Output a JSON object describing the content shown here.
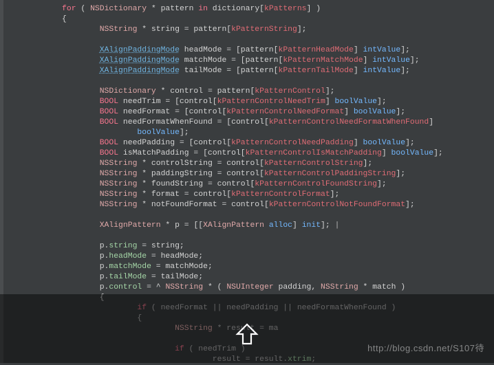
{
  "watermark": "http://blog.csdn.net/S107待",
  "lines": [
    {
      "indent": 3,
      "tokens": [
        {
          "t": "for",
          "c": "kw"
        },
        {
          "t": " ( ",
          "c": "pl"
        },
        {
          "t": "NSDictionary",
          "c": "type"
        },
        {
          "t": " * pattern ",
          "c": "pl"
        },
        {
          "t": "in",
          "c": "kw"
        },
        {
          "t": " dictionary[",
          "c": "pl"
        },
        {
          "t": "kPatterns",
          "c": "key"
        },
        {
          "t": "] )",
          "c": "pl"
        }
      ]
    },
    {
      "indent": 3,
      "tokens": [
        {
          "t": "{",
          "c": "pl"
        }
      ]
    },
    {
      "indent": 5,
      "tokens": [
        {
          "t": "NSString",
          "c": "type"
        },
        {
          "t": " * string = pattern[",
          "c": "pl"
        },
        {
          "t": "kPatternString",
          "c": "key"
        },
        {
          "t": "];",
          "c": "pl"
        }
      ]
    },
    {
      "indent": 0,
      "tokens": []
    },
    {
      "indent": 5,
      "tokens": [
        {
          "t": "XAlignPaddingMode",
          "c": "link"
        },
        {
          "t": " headMode = [pattern[",
          "c": "pl"
        },
        {
          "t": "kPatternHeadMode",
          "c": "key"
        },
        {
          "t": "] ",
          "c": "pl"
        },
        {
          "t": "intValue",
          "c": "msg"
        },
        {
          "t": "];",
          "c": "pl"
        }
      ]
    },
    {
      "indent": 5,
      "tokens": [
        {
          "t": "XAlignPaddingMode",
          "c": "link"
        },
        {
          "t": " matchMode = [pattern[",
          "c": "pl"
        },
        {
          "t": "kPatternMatchMode",
          "c": "key"
        },
        {
          "t": "] ",
          "c": "pl"
        },
        {
          "t": "intValue",
          "c": "msg"
        },
        {
          "t": "];",
          "c": "pl"
        }
      ]
    },
    {
      "indent": 5,
      "tokens": [
        {
          "t": "XAlignPaddingMode",
          "c": "link"
        },
        {
          "t": " tailMode = [pattern[",
          "c": "pl"
        },
        {
          "t": "kPatternTailMode",
          "c": "key"
        },
        {
          "t": "] ",
          "c": "pl"
        },
        {
          "t": "intValue",
          "c": "msg"
        },
        {
          "t": "];",
          "c": "pl"
        }
      ]
    },
    {
      "indent": 0,
      "tokens": []
    },
    {
      "indent": 5,
      "tokens": [
        {
          "t": "NSDictionary",
          "c": "type"
        },
        {
          "t": " * control = pattern[",
          "c": "pl"
        },
        {
          "t": "kPatternControl",
          "c": "key"
        },
        {
          "t": "];",
          "c": "pl"
        }
      ]
    },
    {
      "indent": 5,
      "tokens": [
        {
          "t": "BOOL",
          "c": "kw"
        },
        {
          "t": " needTrim = [control[",
          "c": "pl"
        },
        {
          "t": "kPatternControlNeedTrim",
          "c": "key"
        },
        {
          "t": "] ",
          "c": "pl"
        },
        {
          "t": "boolValue",
          "c": "msg"
        },
        {
          "t": "];",
          "c": "pl"
        }
      ]
    },
    {
      "indent": 5,
      "tokens": [
        {
          "t": "BOOL",
          "c": "kw"
        },
        {
          "t": " needFormat = [control[",
          "c": "pl"
        },
        {
          "t": "kPatternControlNeedFormat",
          "c": "key"
        },
        {
          "t": "] ",
          "c": "pl"
        },
        {
          "t": "boolValue",
          "c": "msg"
        },
        {
          "t": "];",
          "c": "pl"
        }
      ]
    },
    {
      "indent": 5,
      "tokens": [
        {
          "t": "BOOL",
          "c": "kw"
        },
        {
          "t": " needFormatWhenFound = [control[",
          "c": "pl"
        },
        {
          "t": "kPatternControlNeedFormatWhenFound",
          "c": "key"
        },
        {
          "t": "] ",
          "c": "pl"
        }
      ]
    },
    {
      "indent": 7,
      "tokens": [
        {
          "t": "boolValue",
          "c": "msg"
        },
        {
          "t": "];",
          "c": "pl"
        }
      ]
    },
    {
      "indent": 5,
      "tokens": [
        {
          "t": "BOOL",
          "c": "kw"
        },
        {
          "t": " needPadding = [control[",
          "c": "pl"
        },
        {
          "t": "kPatternControlNeedPadding",
          "c": "key"
        },
        {
          "t": "] ",
          "c": "pl"
        },
        {
          "t": "boolValue",
          "c": "msg"
        },
        {
          "t": "];",
          "c": "pl"
        }
      ]
    },
    {
      "indent": 5,
      "tokens": [
        {
          "t": "BOOL",
          "c": "kw"
        },
        {
          "t": " isMatchPadding = [control[",
          "c": "pl"
        },
        {
          "t": "kPatternControlIsMatchPadding",
          "c": "key"
        },
        {
          "t": "] ",
          "c": "pl"
        },
        {
          "t": "boolValue",
          "c": "msg"
        },
        {
          "t": "];",
          "c": "pl"
        }
      ]
    },
    {
      "indent": 5,
      "tokens": [
        {
          "t": "NSString",
          "c": "type"
        },
        {
          "t": " * controlString = control[",
          "c": "pl"
        },
        {
          "t": "kPatternControlString",
          "c": "key"
        },
        {
          "t": "];",
          "c": "pl"
        }
      ]
    },
    {
      "indent": 5,
      "tokens": [
        {
          "t": "NSString",
          "c": "type"
        },
        {
          "t": " * paddingString = control[",
          "c": "pl"
        },
        {
          "t": "kPatternControlPaddingString",
          "c": "key"
        },
        {
          "t": "];",
          "c": "pl"
        }
      ]
    },
    {
      "indent": 5,
      "tokens": [
        {
          "t": "NSString",
          "c": "type"
        },
        {
          "t": " * foundString = control[",
          "c": "pl"
        },
        {
          "t": "kPatternControlFoundString",
          "c": "key"
        },
        {
          "t": "];",
          "c": "pl"
        }
      ]
    },
    {
      "indent": 5,
      "tokens": [
        {
          "t": "NSString",
          "c": "type"
        },
        {
          "t": " * format = control[",
          "c": "pl"
        },
        {
          "t": "kPatternControlFormat",
          "c": "key"
        },
        {
          "t": "];",
          "c": "pl"
        }
      ]
    },
    {
      "indent": 5,
      "tokens": [
        {
          "t": "NSString",
          "c": "type"
        },
        {
          "t": " * notFoundFormat = control[",
          "c": "pl"
        },
        {
          "t": "kPatternControlNotFoundFormat",
          "c": "key"
        },
        {
          "t": "];",
          "c": "pl"
        }
      ]
    },
    {
      "indent": 0,
      "tokens": []
    },
    {
      "indent": 5,
      "tokens": [
        {
          "t": "XAlignPattern",
          "c": "type"
        },
        {
          "t": " * p = [[",
          "c": "pl"
        },
        {
          "t": "XAlignPattern",
          "c": "type"
        },
        {
          "t": " ",
          "c": "pl"
        },
        {
          "t": "alloc",
          "c": "msg"
        },
        {
          "t": "] ",
          "c": "pl"
        },
        {
          "t": "init",
          "c": "msg"
        },
        {
          "t": "]; ",
          "c": "pl"
        },
        {
          "t": "|",
          "c": "dim"
        }
      ]
    },
    {
      "indent": 0,
      "tokens": []
    },
    {
      "indent": 5,
      "tokens": [
        {
          "t": "p.",
          "c": "pl"
        },
        {
          "t": "string",
          "c": "prop"
        },
        {
          "t": " = string;",
          "c": "pl"
        }
      ]
    },
    {
      "indent": 5,
      "tokens": [
        {
          "t": "p.",
          "c": "pl"
        },
        {
          "t": "headMode",
          "c": "prop"
        },
        {
          "t": " = headMode;",
          "c": "pl"
        }
      ]
    },
    {
      "indent": 5,
      "tokens": [
        {
          "t": "p.",
          "c": "pl"
        },
        {
          "t": "matchMode",
          "c": "prop"
        },
        {
          "t": " = matchMode;",
          "c": "pl"
        }
      ]
    },
    {
      "indent": 5,
      "tokens": [
        {
          "t": "p.",
          "c": "pl"
        },
        {
          "t": "tailMode",
          "c": "prop"
        },
        {
          "t": " = tailMode;",
          "c": "pl"
        }
      ]
    },
    {
      "indent": 5,
      "tokens": [
        {
          "t": "p.",
          "c": "pl"
        },
        {
          "t": "control",
          "c": "prop"
        },
        {
          "t": " = ^ ",
          "c": "pl"
        },
        {
          "t": "NSString",
          "c": "type"
        },
        {
          "t": " * ( ",
          "c": "pl"
        },
        {
          "t": "NSUInteger",
          "c": "type"
        },
        {
          "t": " padding, ",
          "c": "pl"
        },
        {
          "t": "NSString",
          "c": "type"
        },
        {
          "t": " * match )",
          "c": "pl"
        }
      ]
    },
    {
      "indent": 5,
      "tokens": [
        {
          "t": "{",
          "c": "pl"
        }
      ]
    },
    {
      "indent": 7,
      "tokens": [
        {
          "t": "if",
          "c": "kw"
        },
        {
          "t": " ( needFormat || needPadding || needFormatWhenFound )",
          "c": "dim"
        }
      ]
    },
    {
      "indent": 7,
      "tokens": [
        {
          "t": "{",
          "c": "dim"
        }
      ]
    },
    {
      "indent": 9,
      "tokens": [
        {
          "t": "NSString",
          "c": "type"
        },
        {
          "t": " * result = ma",
          "c": "dim"
        }
      ]
    },
    {
      "indent": 0,
      "tokens": []
    },
    {
      "indent": 9,
      "tokens": [
        {
          "t": "if",
          "c": "kw"
        },
        {
          "t": " ( needTrim )",
          "c": "dim"
        }
      ]
    },
    {
      "indent": 11,
      "tokens": [
        {
          "t": "result = result.",
          "c": "dim"
        },
        {
          "t": "xtrim",
          "c": "prop"
        },
        {
          "t": ";",
          "c": "dim"
        }
      ]
    }
  ]
}
